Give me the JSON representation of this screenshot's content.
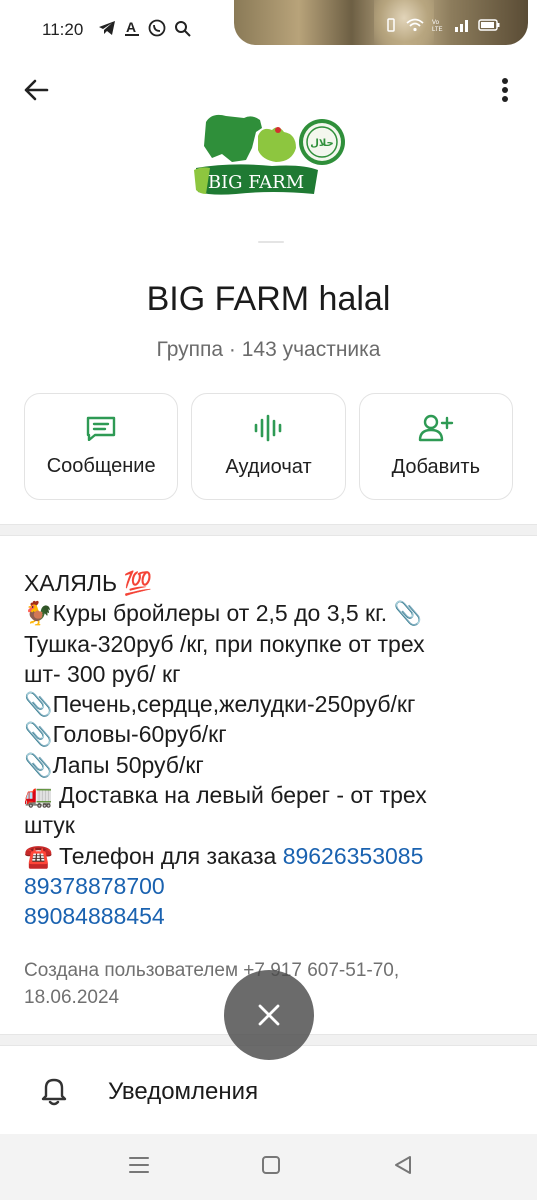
{
  "status_bar": {
    "time": "11:20",
    "left_icons": [
      "telegram-icon",
      "text-a-icon",
      "viber-icon",
      "search-icon"
    ],
    "right_icons": [
      "vibrate-icon",
      "wifi-icon",
      "volte-icon",
      "signal-icon",
      "battery-icon"
    ]
  },
  "header": {
    "back_icon": "arrow-left-icon",
    "menu_icon": "more-vertical-icon"
  },
  "logo": {
    "text": "BIG FARM",
    "seal_text": "حلال"
  },
  "group": {
    "title": "BIG FARM halal",
    "subtitle": "Группа · 143 участника"
  },
  "actions": [
    {
      "label": "Сообщение",
      "icon": "message-icon"
    },
    {
      "label": "Аудиочат",
      "icon": "audio-wave-icon"
    },
    {
      "label": "Добавить",
      "icon": "add-user-icon"
    }
  ],
  "description": {
    "lines": [
      "ХАЛЯЛЬ 💯",
      "🐓Куры бройлеры от 2,5 до 3,5 кг. 📎",
      "Тушка-320руб /кг, при покупке от трех",
      "шт- 300 руб/ кг",
      "📎Печень,сердце,желудки-250руб/кг",
      "📎Головы-60руб/кг",
      "📎Лапы 50руб/кг",
      "🚛 Доставка на левый берег - от трех",
      "штук"
    ],
    "phone_prefix": "☎️ Телефон для заказа ",
    "phones": [
      "89626353085",
      "89378878700",
      "89084888454"
    ],
    "created_line1": "Создана пользователем +7 917 607-51-70,",
    "created_line2": "18.06.2024"
  },
  "notifications": {
    "label": "Уведомления",
    "icon": "bell-icon"
  },
  "accent_color": "#2e9a54",
  "link_color": "#1a62b0",
  "nav": [
    "menu-icon",
    "home-square-icon",
    "back-triangle-icon"
  ]
}
